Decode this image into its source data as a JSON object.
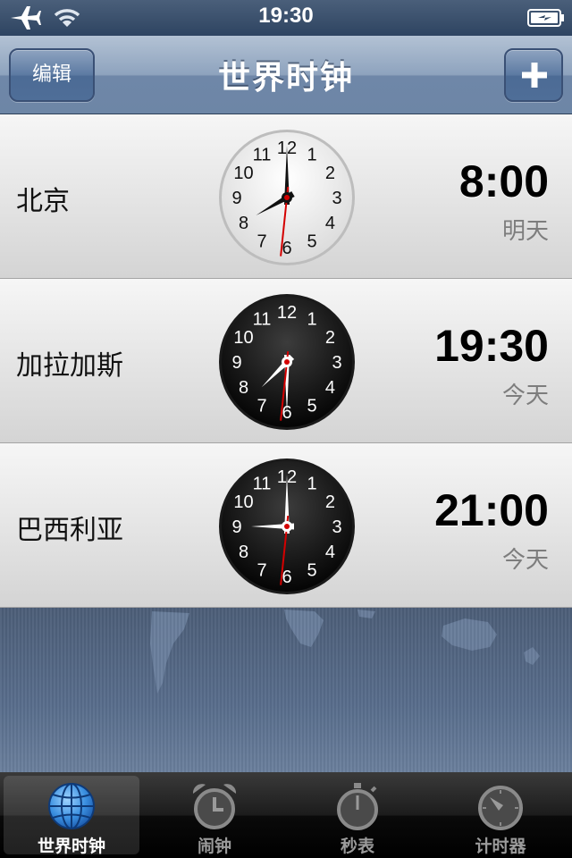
{
  "status_bar": {
    "time": "19:30"
  },
  "nav": {
    "edit_label": "编辑",
    "title": "世界时钟",
    "add_icon": "plus-icon"
  },
  "cities": [
    {
      "name": "北京",
      "time": "8:00",
      "day": "明天",
      "hour": 8,
      "minute": 0,
      "second": 31,
      "face": "light"
    },
    {
      "name": "加拉加斯",
      "time": "19:30",
      "day": "今天",
      "hour": 19,
      "minute": 30,
      "second": 31,
      "face": "dark"
    },
    {
      "name": "巴西利亚",
      "time": "21:00",
      "day": "今天",
      "hour": 21,
      "minute": 0,
      "second": 31,
      "face": "dark"
    }
  ],
  "tabs": [
    {
      "label": "世界时钟",
      "icon": "globe-icon",
      "active": true
    },
    {
      "label": "闹钟",
      "icon": "alarm-clock-icon",
      "active": false
    },
    {
      "label": "秒表",
      "icon": "stopwatch-icon",
      "active": false
    },
    {
      "label": "计时器",
      "icon": "timer-icon",
      "active": false
    }
  ],
  "colors": {
    "second_hand": "#d40000",
    "active_tab_icon": "#3a8fe0"
  }
}
